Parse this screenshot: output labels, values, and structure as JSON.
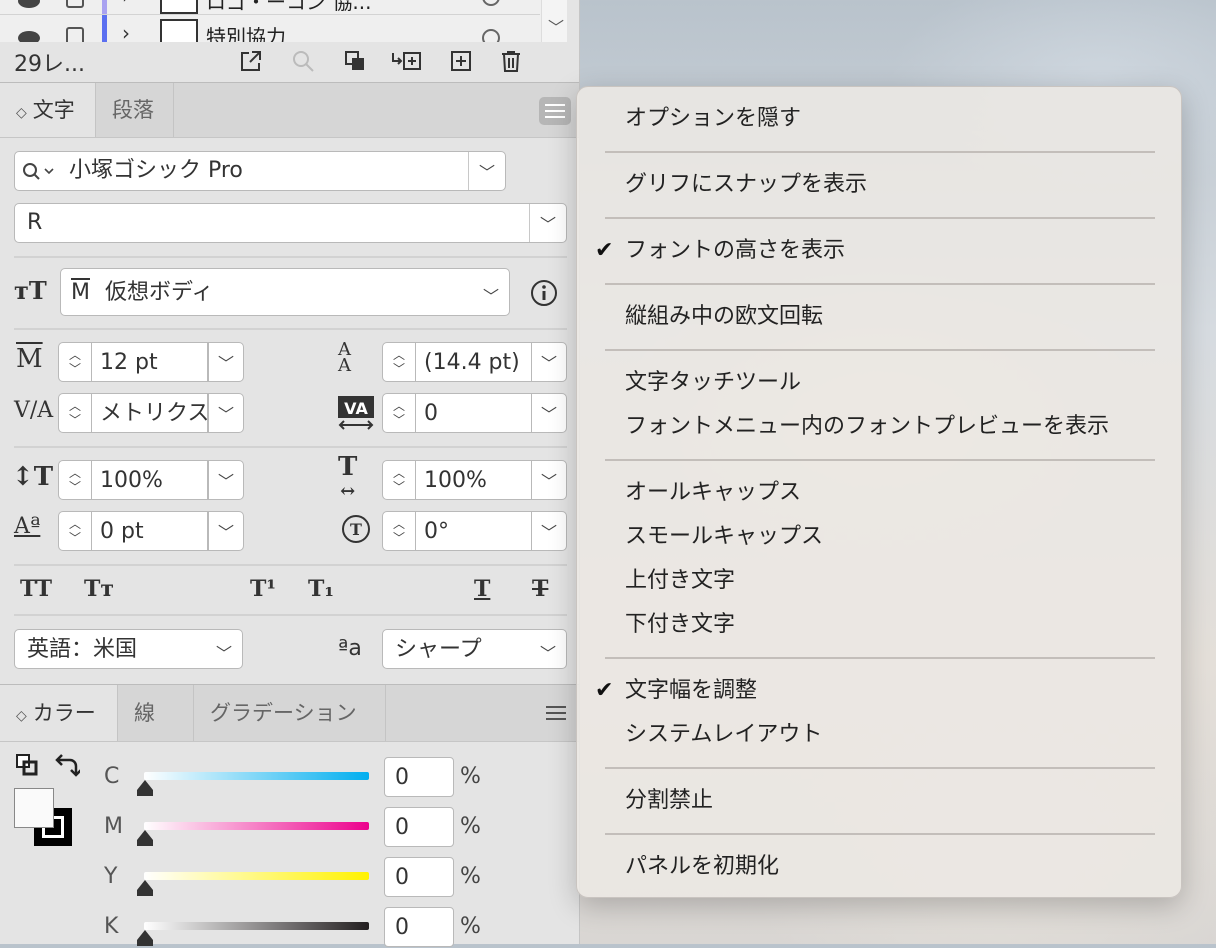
{
  "layers": {
    "rows": [
      {
        "name": "ロゴ・ーコン 協..."
      },
      {
        "name": "特別協力"
      }
    ],
    "count_label": "29レ...",
    "layer_colors": [
      "#a9a2f0",
      "#5b6ff0"
    ]
  },
  "character_panel": {
    "tabs": [
      "文字",
      "段落"
    ],
    "font_family": "小塚ゴシック Pro",
    "font_style": "R",
    "frame_mode": "仮想ボディ",
    "size": "12 pt",
    "leading": "(14.4 pt)",
    "kerning": "メトリクス",
    "tracking": "0",
    "vertical_scale": "100%",
    "horizontal_scale": "100%",
    "baseline_shift": "0 pt",
    "rotation": "0°",
    "language": "英語：米国",
    "antialias": "シャープ",
    "mark_glyph": "M",
    "aa_glyph": "ªa"
  },
  "color_panel": {
    "tabs": [
      "カラー",
      "線",
      "グラデーション"
    ],
    "channels": [
      {
        "label": "C",
        "value": "0",
        "unit": "%",
        "color": "#00aeef"
      },
      {
        "label": "M",
        "value": "0",
        "unit": "%",
        "color": "#ec008c"
      },
      {
        "label": "Y",
        "value": "0",
        "unit": "%",
        "color": "#fff200"
      },
      {
        "label": "K",
        "value": "0",
        "unit": "%",
        "color": "#231f20"
      }
    ]
  },
  "context_menu": {
    "items": [
      {
        "label": "オプションを隠す",
        "checked": false
      },
      {
        "label": "グリフにスナップを表示",
        "checked": false
      },
      {
        "label": "フォントの高さを表示",
        "checked": true
      },
      {
        "label": "縦組み中の欧文回転",
        "checked": false
      },
      {
        "label": "文字タッチツール",
        "checked": false
      },
      {
        "label": "フォントメニュー内のフォントプレビューを表示",
        "checked": false
      },
      {
        "label": "オールキャップス",
        "checked": false
      },
      {
        "label": "スモールキャップス",
        "checked": false
      },
      {
        "label": "上付き文字",
        "checked": false
      },
      {
        "label": "下付き文字",
        "checked": false
      },
      {
        "label": "文字幅を調整",
        "checked": true
      },
      {
        "label": "システムレイアウト",
        "checked": false
      },
      {
        "label": "分割禁止",
        "checked": false
      },
      {
        "label": "パネルを初期化",
        "checked": false
      }
    ],
    "check_glyph": "✔"
  }
}
